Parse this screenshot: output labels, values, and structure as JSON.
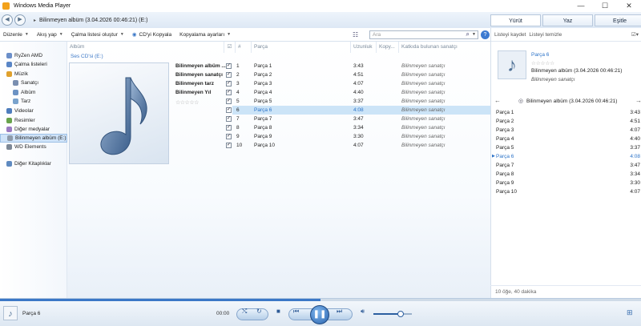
{
  "window": {
    "title": "Windows Media Player",
    "controls": {
      "minimize": "—",
      "maximize": "☐",
      "close": "✕"
    }
  },
  "nav": {
    "back": "◀",
    "forward": "▶",
    "breadcrumb_sep": "▸",
    "breadcrumb": "Bilinmeyen albüm (3.04.2026 00:46:21) (E:)"
  },
  "tabs": [
    {
      "label": "Yürüt"
    },
    {
      "label": "Yaz"
    },
    {
      "label": "Eşitle"
    }
  ],
  "toolbar": {
    "organize": "Düzenle",
    "rip": "Akış yap",
    "create_playlist": "Çalma listesi oluştur",
    "rip_cd": "CD'yi Kopyala",
    "rip_settings": "Kopyalama ayarları",
    "search_placeholder": "Ara"
  },
  "sidebar": {
    "items": [
      {
        "label": "RyZen AMD",
        "icon": "user-icon",
        "color": "#6b8fc9",
        "level": 0
      },
      {
        "label": "Çalma listeleri",
        "icon": "playlist-icon",
        "color": "#5a86c6",
        "level": 0
      },
      {
        "label": "Müzik",
        "icon": "music-icon",
        "color": "#e0a12d",
        "level": 0
      },
      {
        "label": "Sanatçı",
        "icon": "artist-icon",
        "color": "#7a8fb0",
        "level": 1
      },
      {
        "label": "Albüm",
        "icon": "album-icon",
        "color": "#6c93c4",
        "level": 1
      },
      {
        "label": "Tarz",
        "icon": "genre-icon",
        "color": "#7aa3cd",
        "level": 1
      },
      {
        "label": "Videolar",
        "icon": "video-icon",
        "color": "#4e7dbd",
        "level": 0
      },
      {
        "label": "Resimler",
        "icon": "picture-icon",
        "color": "#68a34c",
        "level": 0
      },
      {
        "label": "Diğer medyalar",
        "icon": "media-icon",
        "color": "#9a7bc2",
        "level": 0
      },
      {
        "label": "Bilinmeyen albüm (E:)",
        "icon": "cd-icon",
        "color": "#8e9bab",
        "level": 0,
        "selected": true
      },
      {
        "label": "WD Elements",
        "icon": "drive-icon",
        "color": "#7d8896",
        "level": 0
      },
      {
        "label": "Diğer Kitaplıklar",
        "icon": "library-icon",
        "color": "#5f8ac0",
        "level": 0
      }
    ]
  },
  "list": {
    "headers": {
      "album": "Albüm",
      "num": "#",
      "title": "Parça",
      "length": "Uzunluk",
      "rip": "Kopy...",
      "artist": "Katkıda bulunan sanatçı"
    },
    "group_label": "Ses CD'si (E:)",
    "album_info": [
      "Bilinmeyen albüm ...",
      "Bilinmeyen sanatçı",
      "Bilinmeyen tarz",
      "Bilinmeyen Yıl"
    ],
    "rating": "☆☆☆☆☆",
    "rows": [
      {
        "n": "1",
        "title": "Parça 1",
        "length": "3:43",
        "artist": "Bilinmeyen sanatçı"
      },
      {
        "n": "2",
        "title": "Parça 2",
        "length": "4:51",
        "artist": "Bilinmeyen sanatçı"
      },
      {
        "n": "3",
        "title": "Parça 3",
        "length": "4:07",
        "artist": "Bilinmeyen sanatçı"
      },
      {
        "n": "4",
        "title": "Parça 4",
        "length": "4:40",
        "artist": "Bilinmeyen sanatçı"
      },
      {
        "n": "5",
        "title": "Parça 5",
        "length": "3:37",
        "artist": "Bilinmeyen sanatçı"
      },
      {
        "n": "6",
        "title": "Parça 6",
        "length": "4:08",
        "artist": "Bilinmeyen sanatçı",
        "selected": true
      },
      {
        "n": "7",
        "title": "Parça 7",
        "length": "3:47",
        "artist": "Bilinmeyen sanatçı"
      },
      {
        "n": "8",
        "title": "Parça 8",
        "length": "3:34",
        "artist": "Bilinmeyen sanatçı"
      },
      {
        "n": "9",
        "title": "Parça 9",
        "length": "3:30",
        "artist": "Bilinmeyen sanatçı"
      },
      {
        "n": "10",
        "title": "Parça 10",
        "length": "4:07",
        "artist": "Bilinmeyen sanatçı"
      }
    ]
  },
  "right": {
    "save_list": "Listeyi kaydet",
    "clear_list": "Listeyi temizle",
    "now_title": "Parça 6",
    "now_rating": "☆☆☆☆☆",
    "now_album": "Bilinmeyen albüm (3.04.2026 00:46:21)",
    "now_artist": "Bilinmeyen sanatçı",
    "list_header": "Bilinmeyen albüm (3.04.2026 00:46:21)",
    "items": [
      {
        "t": "Parça 1",
        "d": "3:43"
      },
      {
        "t": "Parça 2",
        "d": "4:51"
      },
      {
        "t": "Parça 3",
        "d": "4:07"
      },
      {
        "t": "Parça 4",
        "d": "4:40"
      },
      {
        "t": "Parça 5",
        "d": "3:37"
      },
      {
        "t": "Parça 6",
        "d": "4:08",
        "current": true
      },
      {
        "t": "Parça 7",
        "d": "3:47"
      },
      {
        "t": "Parça 8",
        "d": "3:34"
      },
      {
        "t": "Parça 9",
        "d": "3:30"
      },
      {
        "t": "Parça 10",
        "d": "4:07"
      }
    ],
    "status": "10 öğe, 40 dakika"
  },
  "player": {
    "track": "Parça 6",
    "elapsed": "00:00",
    "progress": 0.5,
    "volume": 0.7
  },
  "colors": {
    "accent": "#3b78c7",
    "selection": "#cce4f7"
  }
}
